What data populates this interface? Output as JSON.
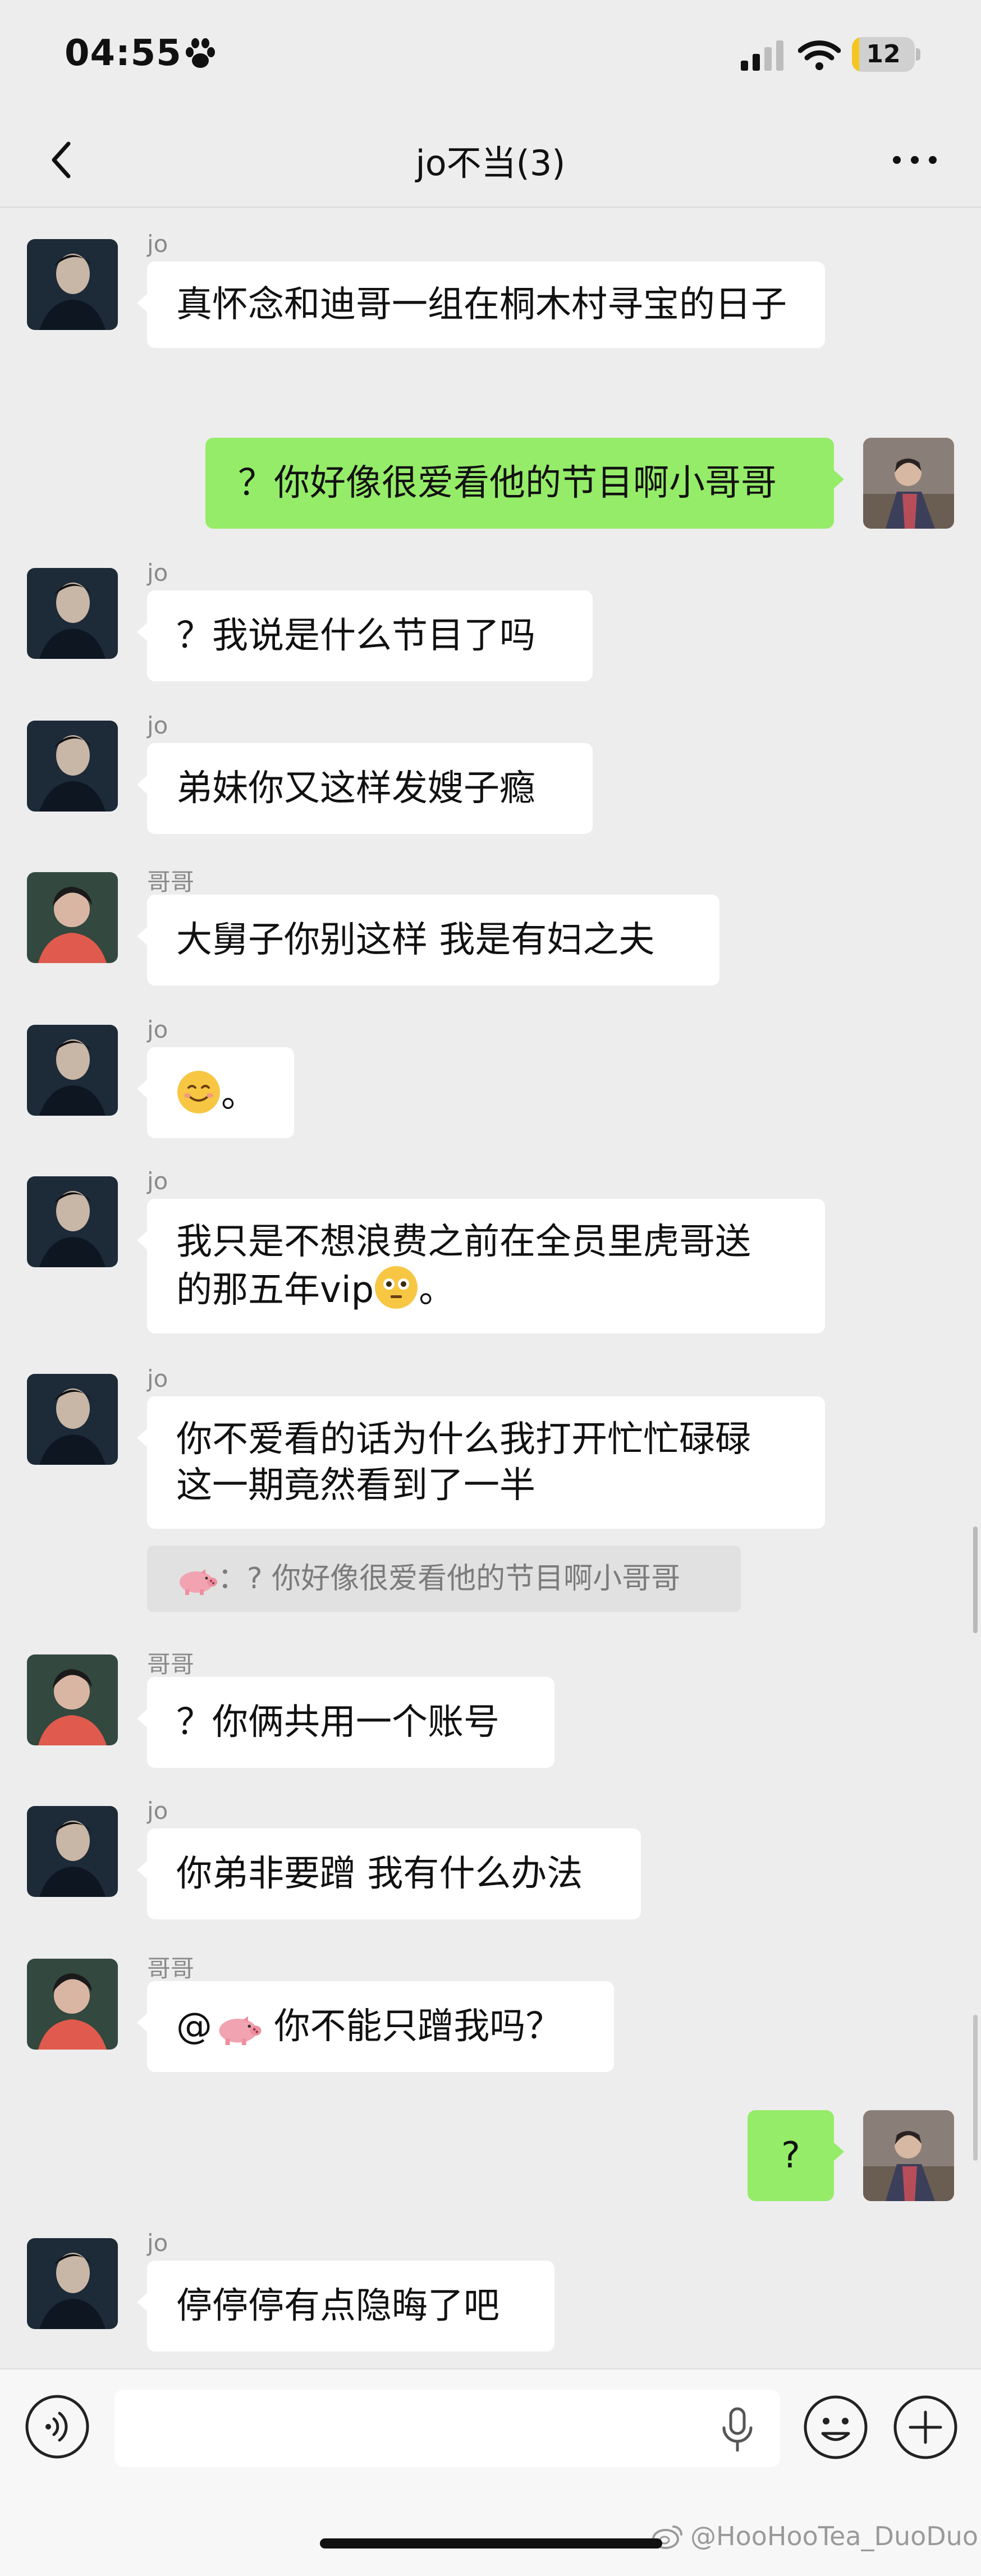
{
  "status_bar": {
    "time": "04:55",
    "battery": "12",
    "battery_fraction": 0.12,
    "battery_color": "#f3c623"
  },
  "nav": {
    "title": "jo不当(3)"
  },
  "colors": {
    "background": "#ededed",
    "incoming_bubble": "#ffffff",
    "outgoing_bubble": "#95ec69"
  },
  "messages": [
    {
      "sender": "jo",
      "text": "真怀念和迪哥一组在桐木村寻宝的日子"
    },
    {
      "sender": "",
      "text": "？你好像很爱看他的节目啊小哥哥",
      "outgoing": true
    },
    {
      "sender": "jo",
      "text": "？我说是什么节目了吗"
    },
    {
      "sender": "jo",
      "text": "弟妹你又这样发嫂子瘾"
    },
    {
      "sender": "哥哥",
      "text": "大舅子你别这样 我是有妇之夫"
    },
    {
      "sender": "jo",
      "text": "。",
      "emoji": "smiling-face-icon"
    },
    {
      "sender": "jo",
      "text_line1": "我只是不想浪费之前在全员里虎哥送",
      "text_line2": "的那五年vip",
      "text_tail": "。",
      "emoji": "flushed-face-icon"
    },
    {
      "sender": "jo",
      "text_line1": "你不爱看的话为什么我打开忙忙碌碌",
      "text_line2": "这一期竟然看到了一半"
    },
    {
      "quote": "：? 你好像很爱看他的节目啊小哥哥",
      "quote_icon": "pig-icon"
    },
    {
      "sender": "哥哥",
      "text": "？你俩共用一个账号"
    },
    {
      "sender": "jo",
      "text": "你弟非要蹭 我有什么办法"
    },
    {
      "sender": "哥哥",
      "text_prefix": "@",
      "text": " 你不能只蹭我吗？",
      "mention_icon": "pig-icon"
    },
    {
      "sender": "",
      "text": "?",
      "outgoing": true
    },
    {
      "sender": "jo",
      "text": "停停停有点隐晦了吧"
    }
  ],
  "input": {
    "placeholder": ""
  },
  "watermark": "@HooHooTea_DuoDuo"
}
